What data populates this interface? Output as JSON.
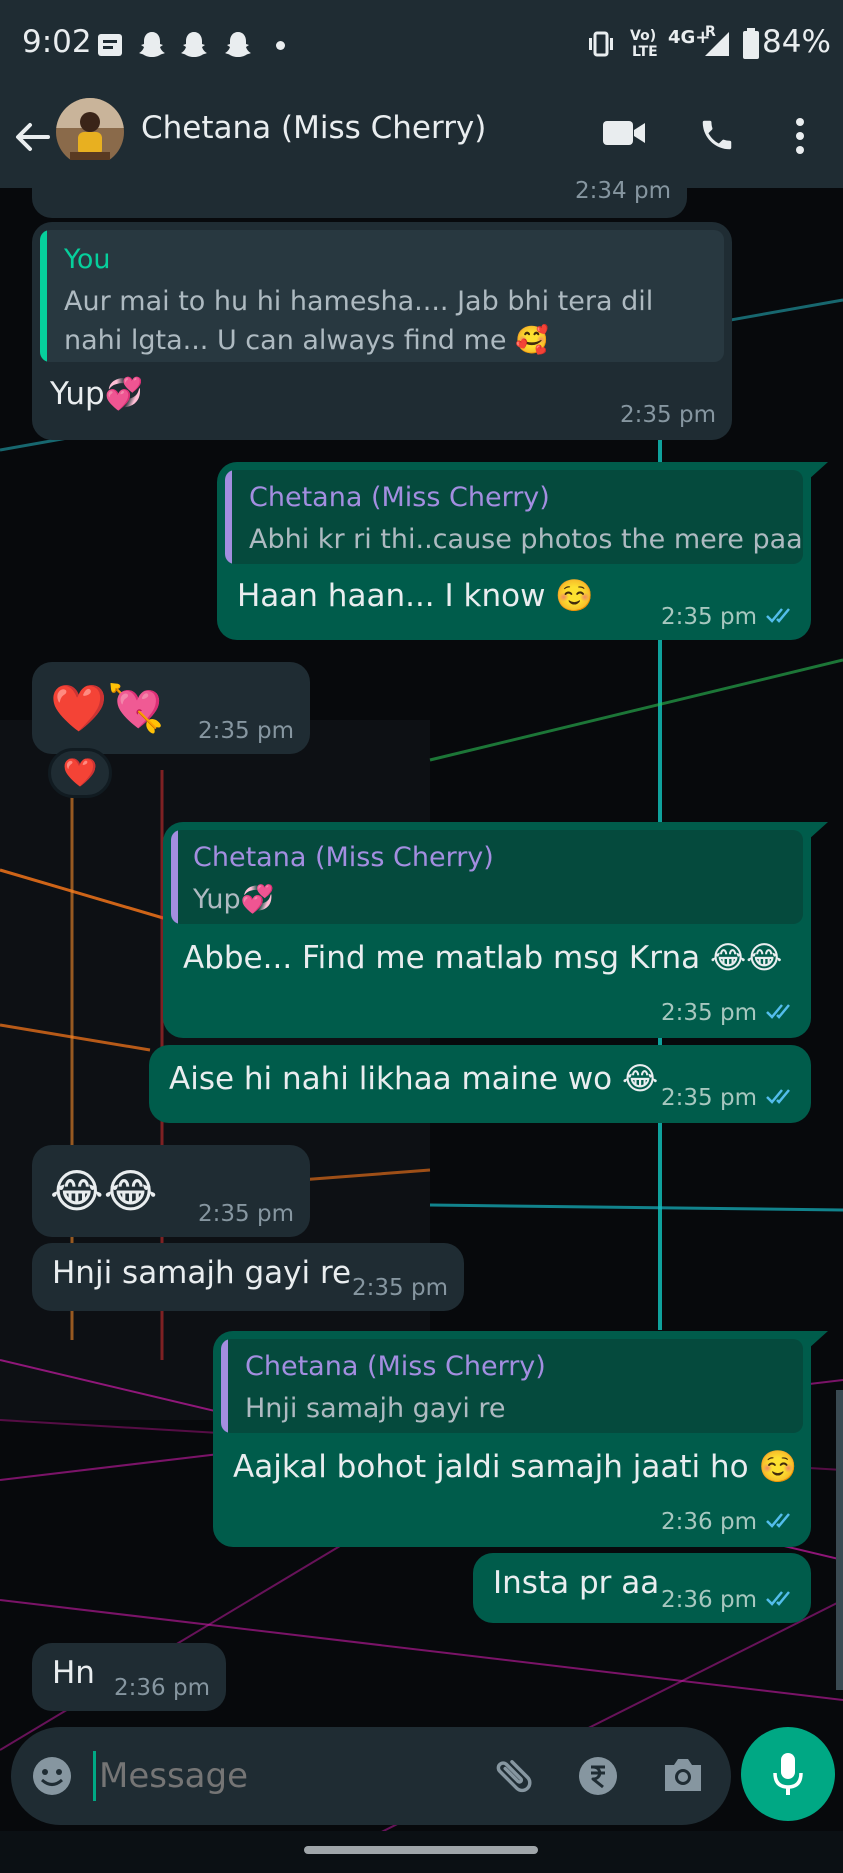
{
  "status_bar": {
    "time": "9:02",
    "signal_labels": [
      "Vo)",
      "LTE",
      "4G+",
      "R"
    ],
    "battery": "84%",
    "left_icons": [
      "notes-icon",
      "snapchat-icon",
      "snapchat-icon",
      "snapchat-icon",
      "dot-icon"
    ],
    "right_icons": [
      "vibrate-icon",
      "signal-icon",
      "battery-icon"
    ]
  },
  "header": {
    "contact_name": "Chetana (Miss Cherry)",
    "icons": [
      "back-arrow-icon",
      "video-call-icon",
      "voice-call-icon",
      "more-options-icon"
    ]
  },
  "messages": [
    {
      "dir": "in",
      "partial": true,
      "time": "2:34 pm"
    },
    {
      "dir": "in",
      "quote": {
        "author": "You",
        "text": "Aur mai to hu hi hamesha.... Jab bhi tera dil nahi lgta... U can always find me 🥰"
      },
      "text": "Yup💞",
      "time": "2:35 pm"
    },
    {
      "dir": "out",
      "quote": {
        "author": "Chetana (Miss Cherry)",
        "text": "Abhi kr ri thi..cause photos the mere paas"
      },
      "text": "Haan haan... I know ☺️",
      "time": "2:35 pm"
    },
    {
      "dir": "in",
      "text": "❤️💘",
      "time": "2:35 pm",
      "reaction": "❤️"
    },
    {
      "dir": "out",
      "quote": {
        "author": "Chetana (Miss Cherry)",
        "text": "Yup💞"
      },
      "text": "Abbe... Find me matlab msg Krna 😂😂",
      "time": "2:35 pm"
    },
    {
      "dir": "out",
      "text": "Aise hi nahi likhaa maine wo 😂",
      "time": "2:35 pm"
    },
    {
      "dir": "in",
      "text": "😂😂",
      "time": "2:35 pm"
    },
    {
      "dir": "in",
      "text": "Hnji samajh gayi re",
      "time": "2:35 pm"
    },
    {
      "dir": "out",
      "quote": {
        "author": "Chetana (Miss Cherry)",
        "text": "Hnji samajh gayi re"
      },
      "text": "Aajkal bohot jaldi samajh jaati ho ☺️",
      "time": "2:36 pm"
    },
    {
      "dir": "out",
      "text": "Insta pr aa",
      "time": "2:36 pm"
    },
    {
      "dir": "in",
      "text": "Hn",
      "time": "2:36 pm"
    }
  ],
  "composer": {
    "placeholder": "Message",
    "icons": [
      "emoji-icon",
      "attach-icon",
      "rupee-payment-icon",
      "camera-icon",
      "mic-icon"
    ]
  },
  "colors": {
    "header_bg": "#1f2c33",
    "incoming_bubble": "#1f2c33",
    "outgoing_bubble": "#005c4b",
    "you_name": "#06cf9c",
    "contact_name_quote": "#a38ee0",
    "read_ticks": "#53bdeb",
    "mic_button": "#00a884"
  }
}
